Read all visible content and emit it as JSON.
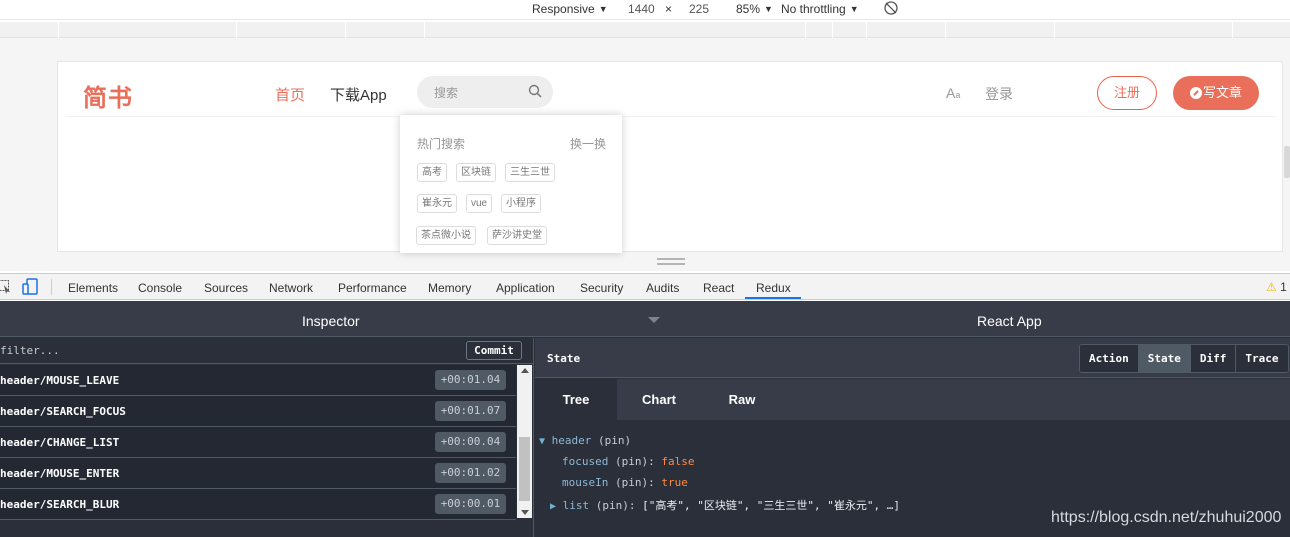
{
  "device_toolbar": {
    "mode": "Responsive",
    "width": "1440",
    "times": "×",
    "height": "225",
    "zoom": "85%",
    "throttling": "No throttling"
  },
  "site": {
    "logo": "简书",
    "nav_home": "首页",
    "nav_app": "下载App",
    "search_placeholder": "搜索",
    "font_icon": "Aa",
    "login": "登录",
    "register": "注册",
    "write": "写文章",
    "hot_search": {
      "title": "热门搜索",
      "switch": "换一换",
      "tags": [
        "高考",
        "区块链",
        "三生三世",
        "崔永元",
        "vue",
        "小程序",
        "茶点微小说",
        "萨沙讲史堂"
      ]
    }
  },
  "devtools": {
    "tabs": [
      "Elements",
      "Console",
      "Sources",
      "Network",
      "Performance",
      "Memory",
      "Application",
      "Security",
      "Audits",
      "React",
      "Redux"
    ],
    "active_tab": "Redux",
    "warnings": "1"
  },
  "redux": {
    "inspector_title": "Inspector",
    "app_name": "React App",
    "filter_placeholder": "filter...",
    "commit_label": "Commit",
    "actions": [
      {
        "name": "header/MOUSE_LEAVE",
        "time": "+00:01.04"
      },
      {
        "name": "header/SEARCH_FOCUS",
        "time": "+00:01.07"
      },
      {
        "name": "header/CHANGE_LIST",
        "time": "+00:00.04"
      },
      {
        "name": "header/MOUSE_ENTER",
        "time": "+00:01.02"
      },
      {
        "name": "header/SEARCH_BLUR",
        "time": "+00:00.01"
      }
    ],
    "state_label": "State",
    "view_buttons": [
      "Action",
      "State",
      "Diff",
      "Trace"
    ],
    "active_view": "State",
    "subtabs": [
      "Tree",
      "Chart",
      "Raw"
    ],
    "active_subtab": "Tree",
    "tree": {
      "header_key": "header",
      "pin": "(pin)",
      "focused_key": "focused",
      "focused_val": "false",
      "mousein_key": "mouseIn",
      "mousein_val": "true",
      "list_key": "list",
      "list_val": "[\"高考\", \"区块链\", \"三生三世\", \"崔永元\", …]"
    }
  },
  "watermark": "https://blog.csdn.net/zhuhui2000",
  "colors": {
    "brand": "#ea6f5a",
    "redux_bg": "#2a2f3a",
    "redux_header": "#373c48",
    "tab_underline": "#1a73e8"
  }
}
